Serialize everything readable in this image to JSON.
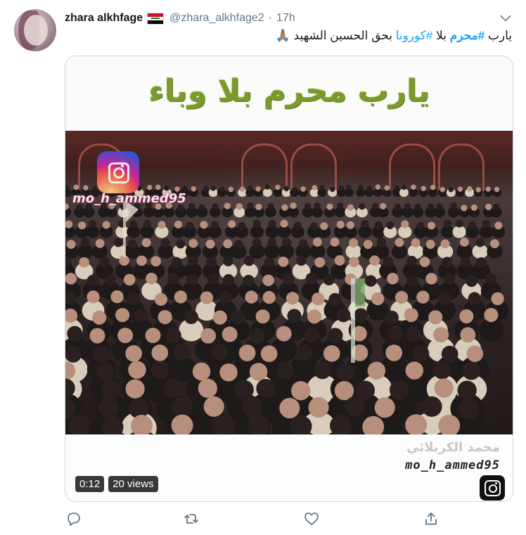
{
  "tweet": {
    "author_name": "zhara alkhfage",
    "author_handle": "@zhara_alkhfage2",
    "separator": "·",
    "time": "17h",
    "text": {
      "part1": "يارب ",
      "hashtag1": "#محرم",
      "part2": " بلا ",
      "hashtag2": "#كورونا",
      "part3": " بحق الحسين الشهيد ",
      "emoji": "🙏🏽"
    }
  },
  "media": {
    "title_overlay": "يارب محرم بلا وباء",
    "watermark_top": "mo_h_ammed95",
    "watermark_arabic": "محمد الكربلائي",
    "watermark_handle": "mo_h_ammed95",
    "duration": "0:12",
    "views": "20 views"
  },
  "icons": {
    "more": "chevron-down-icon",
    "reply": "reply-icon",
    "retweet": "retweet-icon",
    "like": "heart-icon",
    "share": "share-icon"
  },
  "colors": {
    "link": "#1da1f2",
    "icon": "#657786",
    "title_green": "#7b9a2c"
  }
}
